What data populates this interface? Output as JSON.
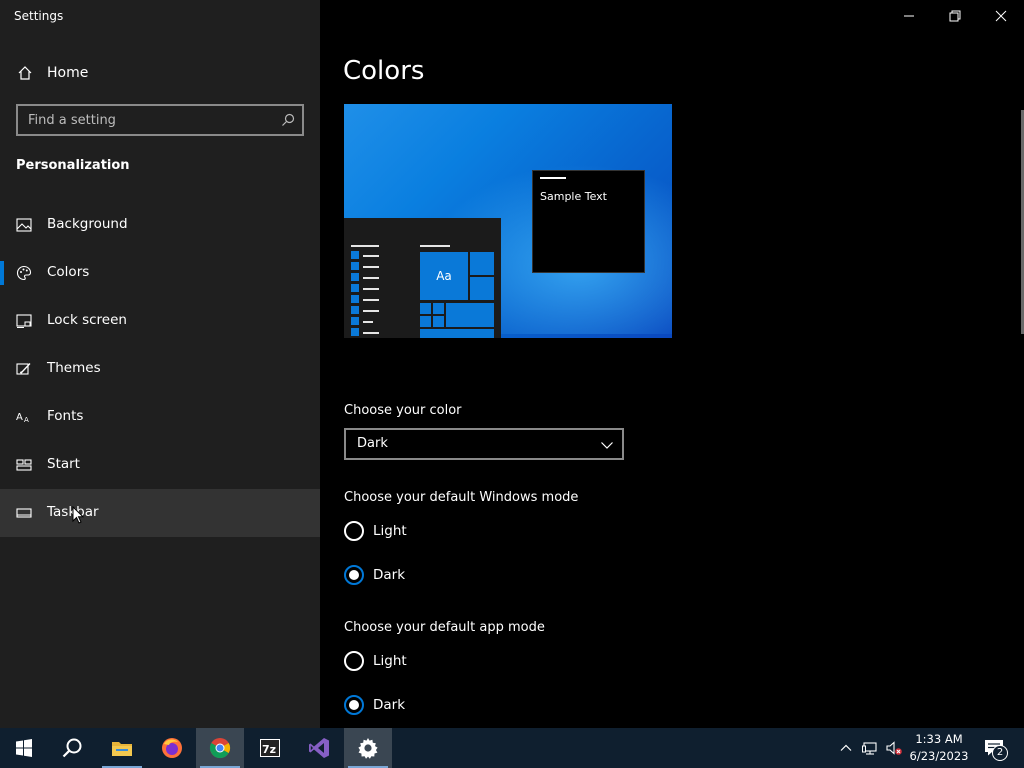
{
  "window": {
    "title": "Settings",
    "controls": [
      "minimize",
      "restore",
      "close"
    ]
  },
  "sidebar": {
    "home_label": "Home",
    "search_placeholder": "Find a setting",
    "section_title": "Personalization",
    "items": [
      {
        "label": "Background",
        "icon": "image-icon"
      },
      {
        "label": "Colors",
        "icon": "palette-icon",
        "active": true
      },
      {
        "label": "Lock screen",
        "icon": "lock-screen-icon"
      },
      {
        "label": "Themes",
        "icon": "brush-icon"
      },
      {
        "label": "Fonts",
        "icon": "font-icon"
      },
      {
        "label": "Start",
        "icon": "start-menu-icon"
      },
      {
        "label": "Taskbar",
        "icon": "taskbar-icon",
        "hovered": true
      }
    ]
  },
  "main": {
    "title": "Colors",
    "preview": {
      "sample_text": "Sample Text",
      "tile_text": "Aa"
    },
    "choose_color": {
      "label": "Choose your color",
      "selected": "Dark"
    },
    "windows_mode": {
      "label": "Choose your default Windows mode",
      "options": [
        {
          "label": "Light",
          "selected": false
        },
        {
          "label": "Dark",
          "selected": true
        }
      ]
    },
    "app_mode": {
      "label": "Choose your default app mode",
      "options": [
        {
          "label": "Light",
          "selected": false
        },
        {
          "label": "Dark",
          "selected": true
        }
      ]
    }
  },
  "taskbar": {
    "apps": [
      "start-icon",
      "search-icon",
      "file-explorer-icon",
      "firefox-icon",
      "chrome-icon",
      "7zip-icon",
      "visual-studio-icon",
      "settings-icon"
    ],
    "tray_icons": [
      "chevron-up-icon",
      "network-icon",
      "volume-muted-icon"
    ],
    "time": "1:33 AM",
    "date": "6/23/2023",
    "notification_count": "2"
  },
  "colors": {
    "accent": "#0078d7",
    "sidebar_bg": "#1f1f1f",
    "main_bg": "#000000",
    "taskbar_bg": "#0f1f2f"
  }
}
